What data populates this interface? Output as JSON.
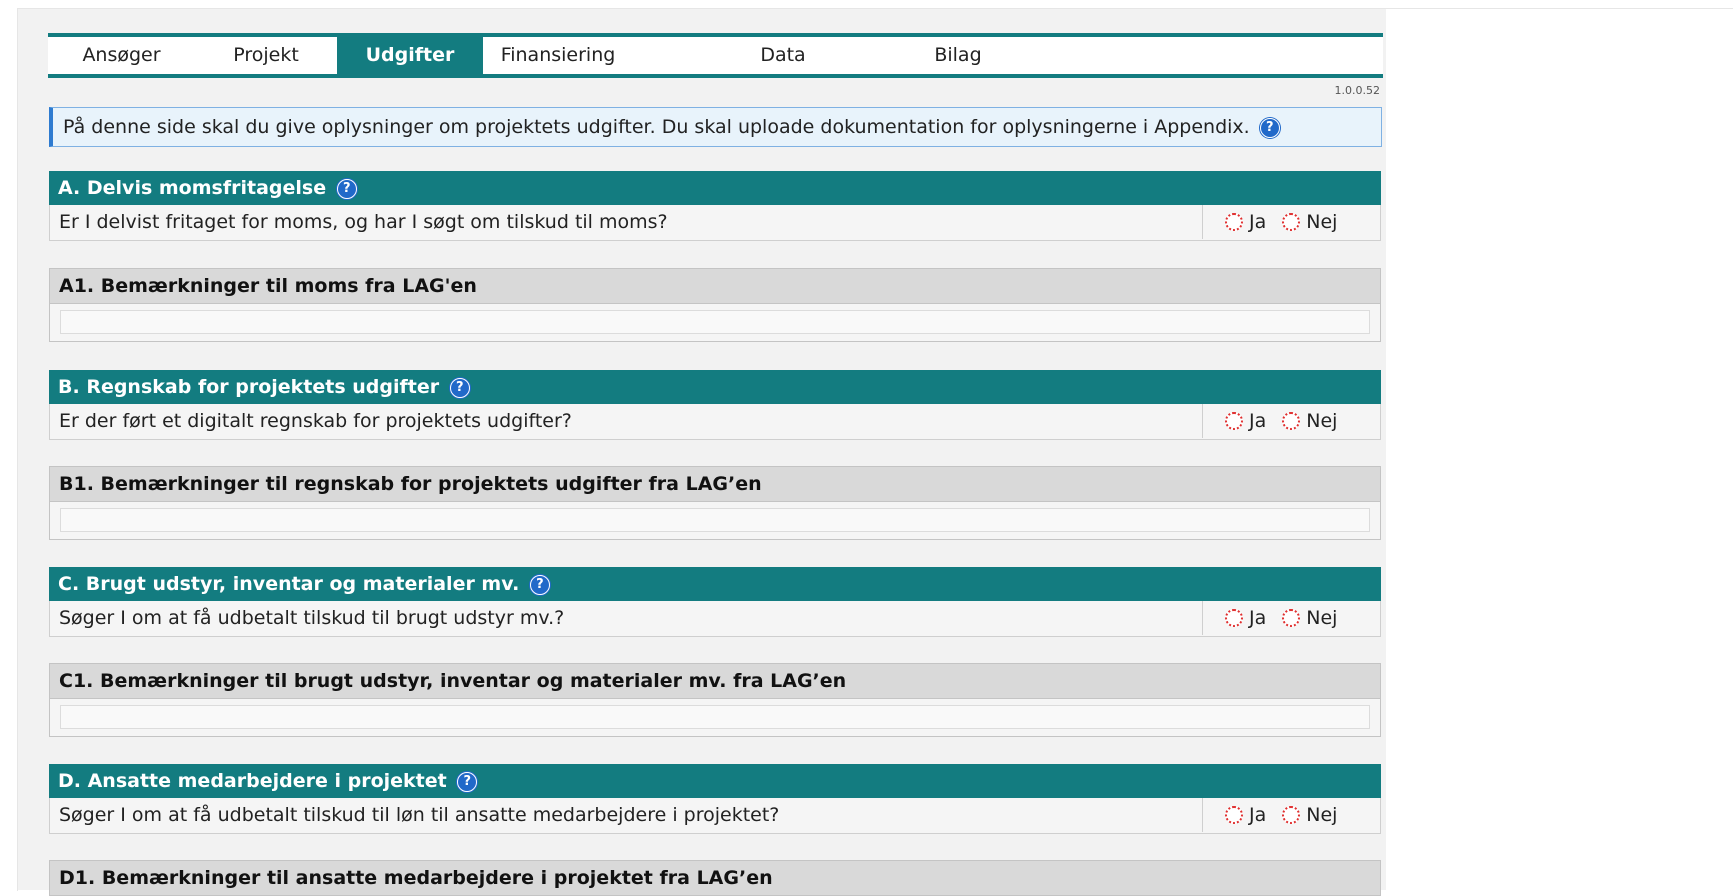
{
  "tabs": [
    {
      "label": "Ansøger"
    },
    {
      "label": "Projekt"
    },
    {
      "label": "Udgifter"
    },
    {
      "label": "Finansiering"
    },
    {
      "label": "Data"
    },
    {
      "label": "Bilag"
    }
  ],
  "version": "1.0.0.52",
  "info_text": "På denne side skal du give oplysninger om projektets udgifter. Du skal uploade dokumentation for oplysningerne i Appendix.",
  "help_glyph": "?",
  "options": {
    "yes": "Ja",
    "no": "Nej"
  },
  "sections": [
    {
      "title": "A. Delvis momsfritagelse",
      "question": "Er I delvist fritaget for moms, og har I søgt om tilskud til moms?",
      "remarks_title": "A1. Bemærkninger til moms fra LAG'en"
    },
    {
      "title": "B. Regnskab for projektets udgifter",
      "question": "Er der ført et digitalt regnskab for projektets udgifter?",
      "remarks_title": "B1. Bemærkninger til regnskab for projektets udgifter fra LAG’en"
    },
    {
      "title": "C. Brugt udstyr, inventar og materialer mv.",
      "question": "Søger I om at få udbetalt tilskud til brugt udstyr mv.?",
      "remarks_title": "C1. Bemærkninger til brugt udstyr, inventar og materialer mv. fra LAG’en"
    },
    {
      "title": "D. Ansatte medarbejdere i projektet",
      "question": "Søger I om at få udbetalt tilskud til løn til ansatte medarbejdere i projektet?",
      "remarks_title": "D1. Bemærkninger til ansatte medarbejdere i projektet fra LAG’en"
    }
  ],
  "colors": {
    "accent": "#137c80",
    "info_border": "#2e7bd0",
    "info_bg": "#e8f3fb",
    "radio_border": "#e03030"
  }
}
